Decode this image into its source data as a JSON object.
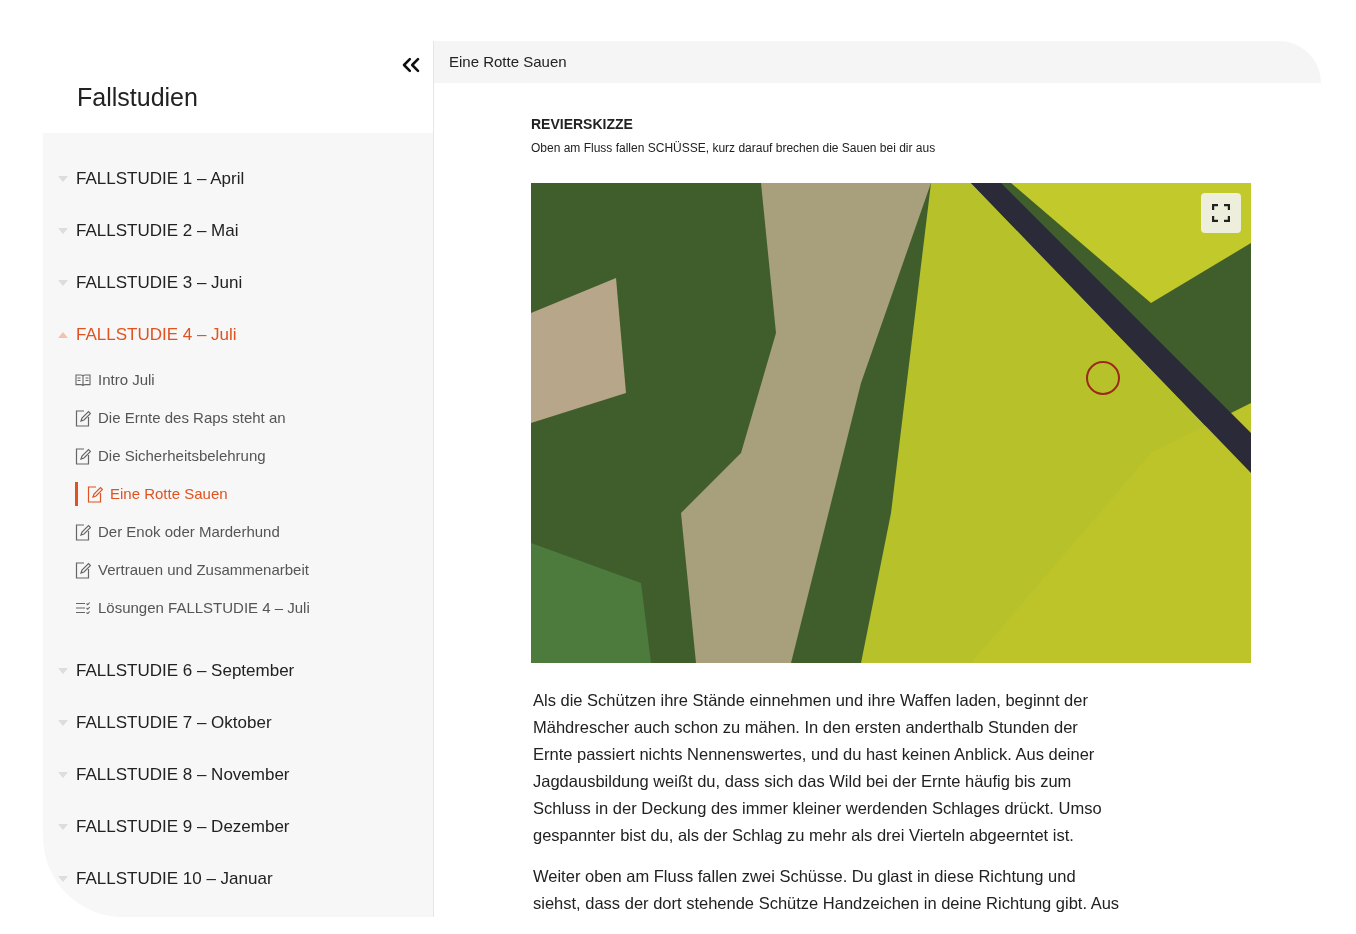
{
  "sidebar": {
    "title": "Fallstudien",
    "chapters": [
      {
        "label": "FALLSTUDIE 1 – April",
        "expanded": false
      },
      {
        "label": "FALLSTUDIE 2 – Mai",
        "expanded": false
      },
      {
        "label": "FALLSTUDIE 3 – Juni",
        "expanded": false
      },
      {
        "label": "FALLSTUDIE 4 – Juli",
        "expanded": true,
        "lessons": [
          {
            "kind": "reading",
            "label": "Intro Juli",
            "selected": false
          },
          {
            "kind": "exercise",
            "label": "Die Ernte des Raps steht an",
            "selected": false
          },
          {
            "kind": "exercise",
            "label": "Die Sicherheitsbelehrung",
            "selected": false
          },
          {
            "kind": "exercise",
            "label": "Eine Rotte Sauen",
            "selected": true
          },
          {
            "kind": "exercise",
            "label": "Der Enok oder Marderhund",
            "selected": false
          },
          {
            "kind": "exercise",
            "label": "Vertrauen und Zusammenarbeit",
            "selected": false
          },
          {
            "kind": "solutions",
            "label": "Lösungen FALLSTUDIE 4 – Juli",
            "selected": false
          }
        ]
      },
      {
        "label": "FALLSTUDIE 6 – September",
        "expanded": false
      },
      {
        "label": "FALLSTUDIE 7 – Oktober",
        "expanded": false
      },
      {
        "label": "FALLSTUDIE 8 – November",
        "expanded": false
      },
      {
        "label": "FALLSTUDIE 9 – Dezember",
        "expanded": false
      },
      {
        "label": "FALLSTUDIE 10 – Januar",
        "expanded": false
      }
    ]
  },
  "content": {
    "title": "Eine Rotte Sauen",
    "heading": "REVIERSKIZZE",
    "caption": "Oben am Fluss fallen SCHÜSSE, kurz darauf brechen die Sauen bei dir aus",
    "paragraphs": [
      "Als die Schützen ihre Stände einnehmen und ihre Waffen laden, beginnt der Mähdrescher auch schon zu mähen. In den ersten anderthalb Stunden der Ernte passiert nichts Nennenswertes, und du hast keinen Anblick. Aus deiner Jagdausbildung weißt du, dass sich das Wild bei der Ernte häufig bis zum Schluss in der Deckung des immer kleiner werdenden Schlages drückt. Umso gespannter bist du, als der Schlag zu mehr als drei Vierteln abgeerntet ist.",
      "Weiter oben am Fluss fallen zwei Schüsse. Du glast in diese Richtung und siehst, dass der dort stehende Schütze Handzeichen in deine Richtung gibt. Aus"
    ]
  }
}
